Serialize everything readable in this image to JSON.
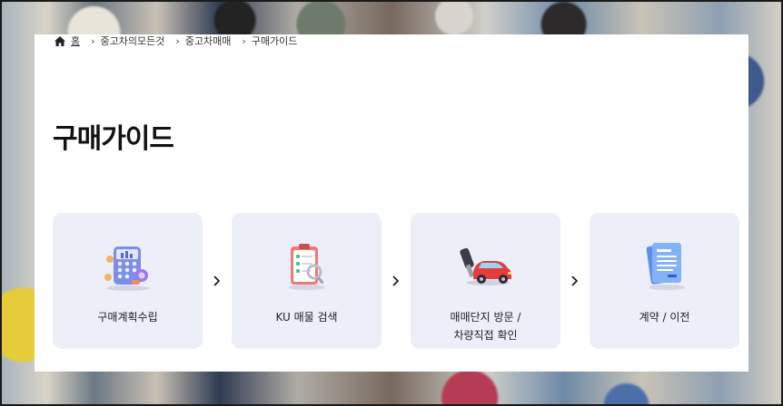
{
  "breadcrumb": {
    "home": "홈",
    "items": [
      "중고차의모든것",
      "중고차매매",
      "구매가이드"
    ]
  },
  "page": {
    "title": "구매가이드"
  },
  "steps": [
    {
      "label": "구매계획수립",
      "icon": "calculator-icon"
    },
    {
      "label": "KU 매물 검색",
      "icon": "checklist-search-icon"
    },
    {
      "label_line1": "매매단지 방문 /",
      "label_line2": "차량직접 확인",
      "icon": "car-key-icon"
    },
    {
      "label": "계약 / 이전",
      "icon": "document-icon"
    }
  ],
  "colors": {
    "card_bg": "#ffffff",
    "step_bg": "#eceef8",
    "title": "#111111"
  }
}
